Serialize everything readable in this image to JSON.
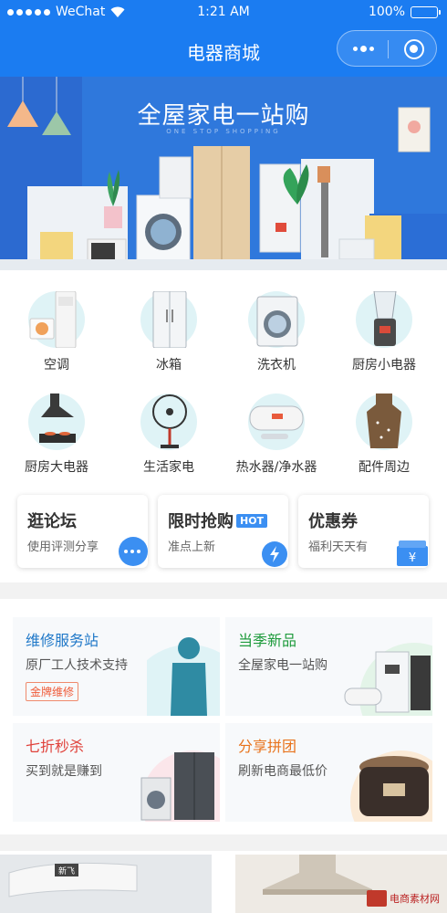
{
  "status": {
    "carrier": "WeChat",
    "time": "1:21 AM",
    "battery": "100%",
    "battery_level": 1.0
  },
  "nav": {
    "title": "电器商城",
    "more_icon": "more-dots-icon",
    "close_icon": "miniprogram-close-icon"
  },
  "banner": {
    "title": "全屋家电一站购",
    "subtitle": "ONE STOP SHOPPING"
  },
  "categories": [
    {
      "label": "空调",
      "icon": "air-conditioner-icon"
    },
    {
      "label": "冰箱",
      "icon": "refrigerator-icon"
    },
    {
      "label": "洗衣机",
      "icon": "washing-machine-icon"
    },
    {
      "label": "厨房小电器",
      "icon": "blender-icon"
    },
    {
      "label": "厨房大电器",
      "icon": "range-hood-icon"
    },
    {
      "label": "生活家电",
      "icon": "electric-fan-icon"
    },
    {
      "label": "热水器/净水器",
      "icon": "water-heater-icon"
    },
    {
      "label": "配件周边",
      "icon": "apron-icon"
    }
  ],
  "quick": [
    {
      "title": "逛论坛",
      "subtitle": "使用评测分享",
      "icon": "chat-bubble-icon"
    },
    {
      "title": "限时抢购",
      "badge": "HOT",
      "subtitle": "准点上新",
      "icon": "alarm-clock-icon"
    },
    {
      "title": "优惠券",
      "subtitle": "福利天天有",
      "icon": "coupon-icon"
    }
  ],
  "services": [
    {
      "title": "维修服务站",
      "subtitle": "原厂工人技术支持",
      "tag": "金牌维修",
      "color": "#1f78c8"
    },
    {
      "title": "当季新品",
      "subtitle": "全屋家电一站购",
      "color": "#1e9b3c"
    },
    {
      "title": "七折秒杀",
      "subtitle": "买到就是赚到",
      "color": "#e0413a"
    },
    {
      "title": "分享拼团",
      "subtitle": "刷新电商最低价",
      "color": "#e8731c"
    }
  ],
  "bottom": {
    "product_brand": "新飞",
    "watermark": "电商素材网"
  },
  "colors": {
    "brand_blue": "#1b7cf1",
    "hot_badge": "#3b8ff2",
    "tile_bg": "#dff3f6"
  }
}
